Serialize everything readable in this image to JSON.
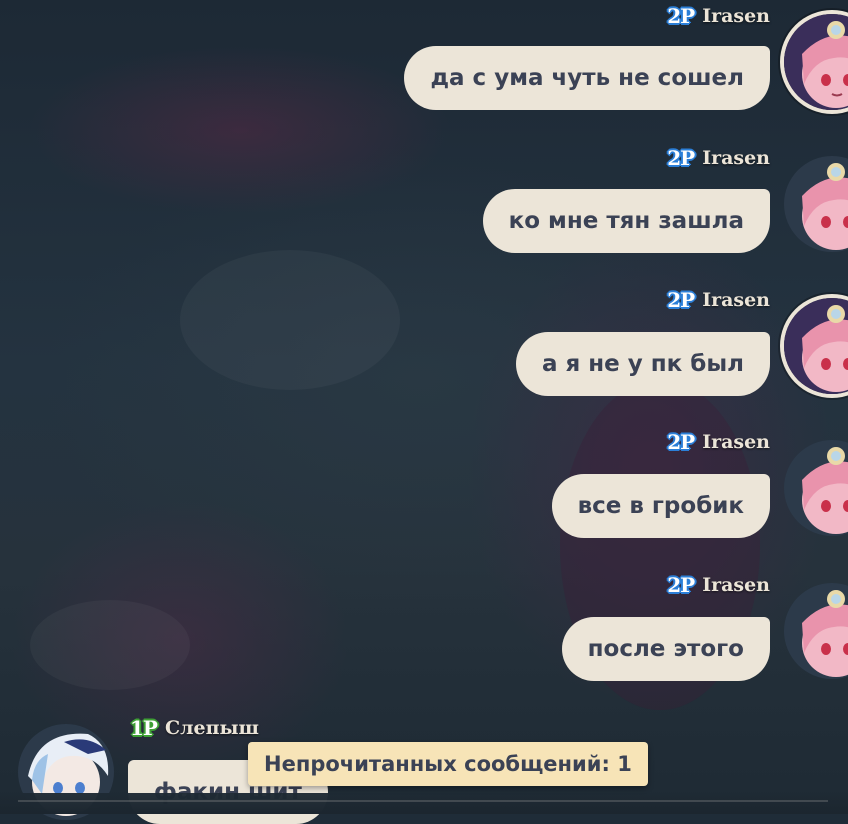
{
  "messages": [
    {
      "player_badge": "2P",
      "sender": "Irasen",
      "text": "да с ума чуть не сошел"
    },
    {
      "player_badge": "2P",
      "sender": "Irasen",
      "text": "ко мне тян зашла"
    },
    {
      "player_badge": "2P",
      "sender": "Irasen",
      "text": "а я не у пк был"
    },
    {
      "player_badge": "2P",
      "sender": "Irasen",
      "text": "все в гробик"
    },
    {
      "player_badge": "2P",
      "sender": "Irasen",
      "text": "после этого"
    }
  ],
  "incoming": {
    "player_badge": "1P",
    "sender": "Слепыш",
    "text": "факин шит"
  },
  "unread_toast": "Непрочитанных сообщений: 1",
  "colors": {
    "bubble": "#ece5d8",
    "bubble_text": "#3b4255",
    "toast_bg": "#f7e4b7",
    "badge_2p": "#2b7fd8",
    "badge_1p": "#3ea034",
    "background": "#1f2c38"
  }
}
